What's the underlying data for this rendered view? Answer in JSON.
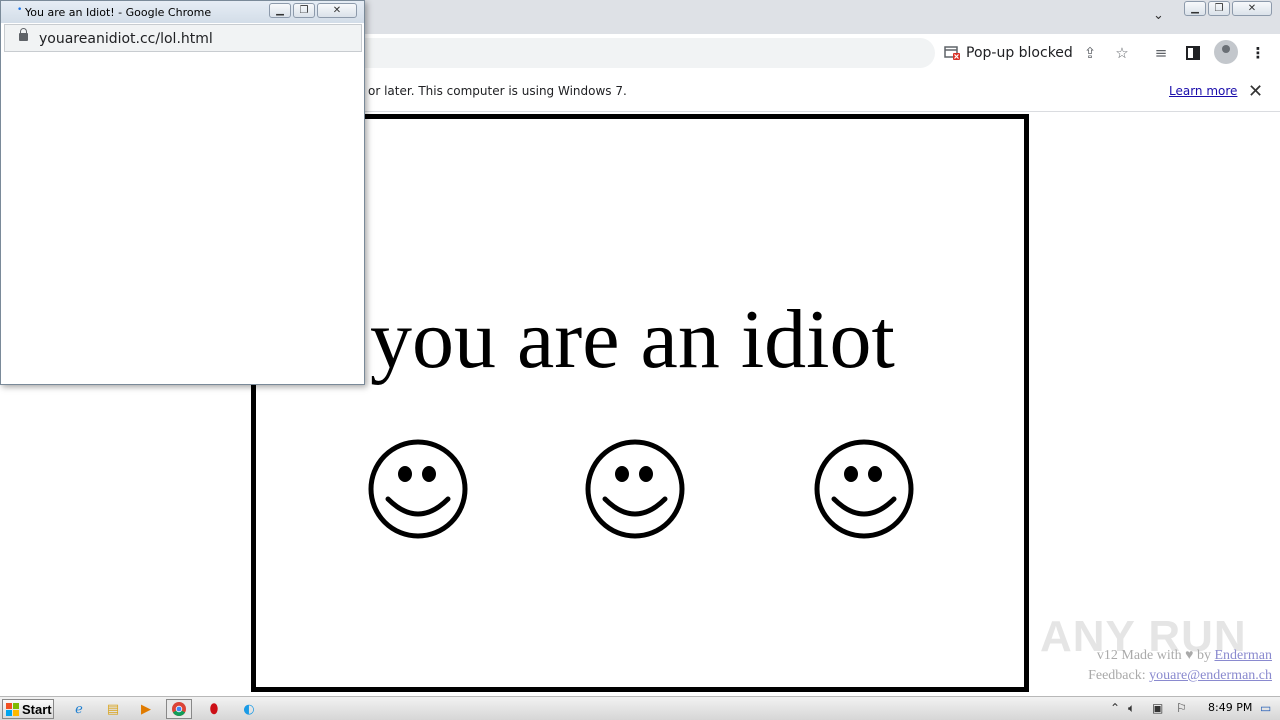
{
  "popup": {
    "title": "You are an Idiot! - Google Chrome",
    "url": "youareanidiot.cc/lol.html"
  },
  "main_window": {
    "popup_blocked_label": "Pop-up blocked"
  },
  "infobar": {
    "message": "or later. This computer is using Windows 7.",
    "learn_more": "Learn more"
  },
  "page": {
    "headline": "you are an idiot",
    "smiley_count": 3,
    "credits_line1_prefix": "v12 Made with",
    "credits_heart": "♥",
    "credits_by": "by",
    "credits_author": "Enderman",
    "credits_feedback_label": "Feedback:",
    "credits_email": "youare@enderman.ch"
  },
  "watermark": "ANY RUN",
  "taskbar": {
    "start_label": "Start",
    "clock": "8:49 PM"
  }
}
